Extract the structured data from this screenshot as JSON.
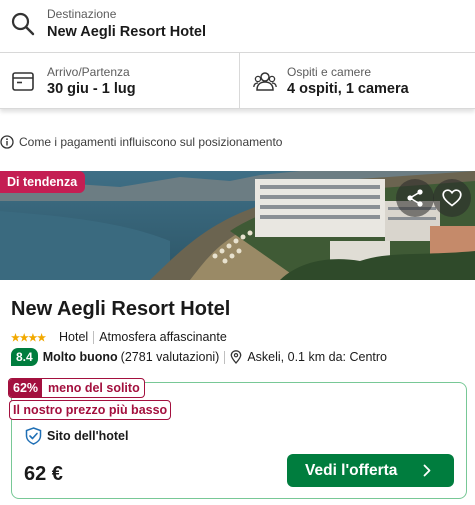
{
  "search": {
    "destination_label": "Destinazione",
    "destination_value": "New Aegli Resort Hotel"
  },
  "dates": {
    "label": "Arrivo/Partenza",
    "value": "30 giu - 1 lug"
  },
  "guests": {
    "label": "Ospiti e camere",
    "value": "4 ospiti, 1 camera"
  },
  "info_text": "Come i pagamenti influiscono sul posizionamento",
  "photo": {
    "trend_badge": "Di tendenza"
  },
  "hotel": {
    "name": "New Aegli Resort Hotel",
    "type": "Hotel",
    "stars": 4,
    "tagline": "Atmosfera affascinante",
    "score": "8.4",
    "score_word": "Molto buono",
    "reviews": "(2781 valutazioni)",
    "location": "Askeli, 0.1 km da: Centro"
  },
  "offer": {
    "discount_pct": "62%",
    "discount_text": "meno del solito",
    "lowest_price_text": "Il nostro prezzo più basso",
    "site": "Sito dell'hotel",
    "price": "62 €",
    "cta": "Vedi l'offerta"
  },
  "colors": {
    "accent_green": "#007d3e",
    "trend_pink": "#c41e53",
    "discount_red": "#a3103e",
    "card_border": "#78c896"
  }
}
